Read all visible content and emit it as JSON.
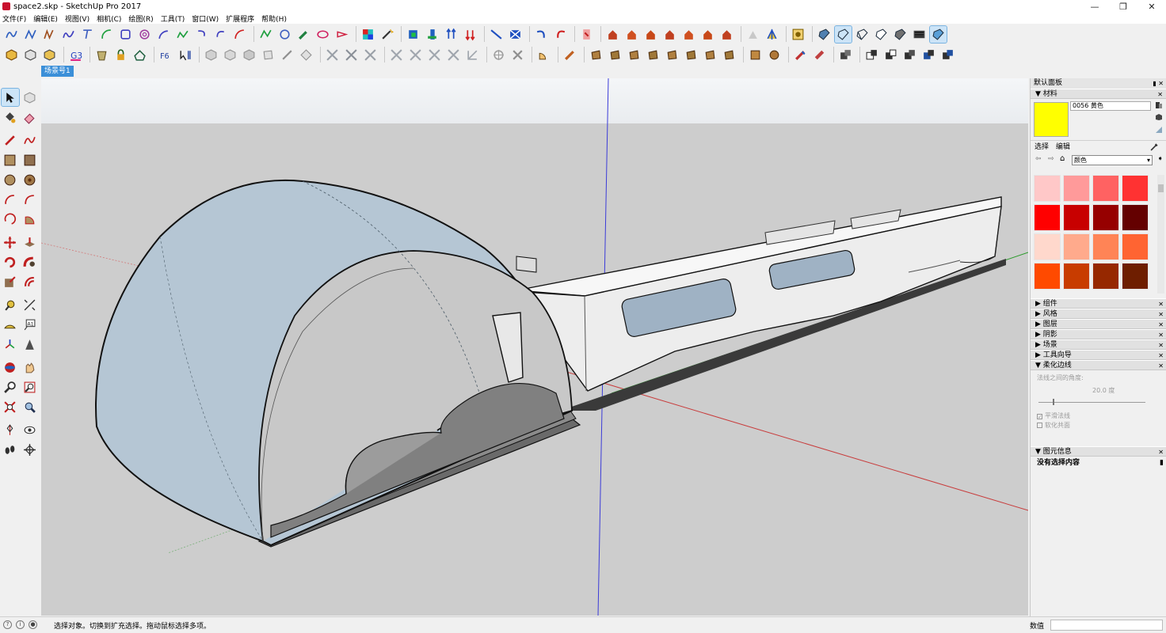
{
  "window": {
    "title": "space2.skp - SketchUp Pro 2017",
    "controls": [
      "—",
      "❐",
      "✕"
    ]
  },
  "menu": [
    "文件(F)",
    "编辑(E)",
    "视图(V)",
    "相机(C)",
    "绘图(R)",
    "工具(T)",
    "窗口(W)",
    "扩展程序",
    "帮助(H)"
  ],
  "scene_tab": "场景号1",
  "panel": {
    "title": "默认面板",
    "materials": {
      "header": "材料",
      "current_name": "0056 黄色",
      "current_color": "#ffff00",
      "tabs": [
        "选择",
        "编辑"
      ],
      "library": "颜色",
      "swatches": [
        "#ffc8c8",
        "#ff9a9a",
        "#ff6262",
        "#ff3232",
        "#ff0000",
        "#c80000",
        "#960000",
        "#640000",
        "#ffd8cc",
        "#ffaa8c",
        "#ff8456",
        "#ff6432",
        "#ff4a00",
        "#c83c00",
        "#962800",
        "#6e1e00"
      ]
    },
    "collapsed_sections": [
      "组件",
      "风格",
      "图层",
      "阴影",
      "场景",
      "工具向导"
    ],
    "soften": {
      "header": "柔化边线",
      "angle_label": "法线之间的角度:",
      "angle_value": "20.0  度",
      "smooth_normals": "平滑法线",
      "soften_coplanar": "软化共面"
    },
    "entity_info": {
      "header": "图元信息",
      "empty_text": "没有选择内容"
    }
  },
  "status": {
    "message": "选择对象。切换到扩充选择。拖动鼠标选择多项。",
    "measurements_label": "数值",
    "measurements_value": ""
  }
}
